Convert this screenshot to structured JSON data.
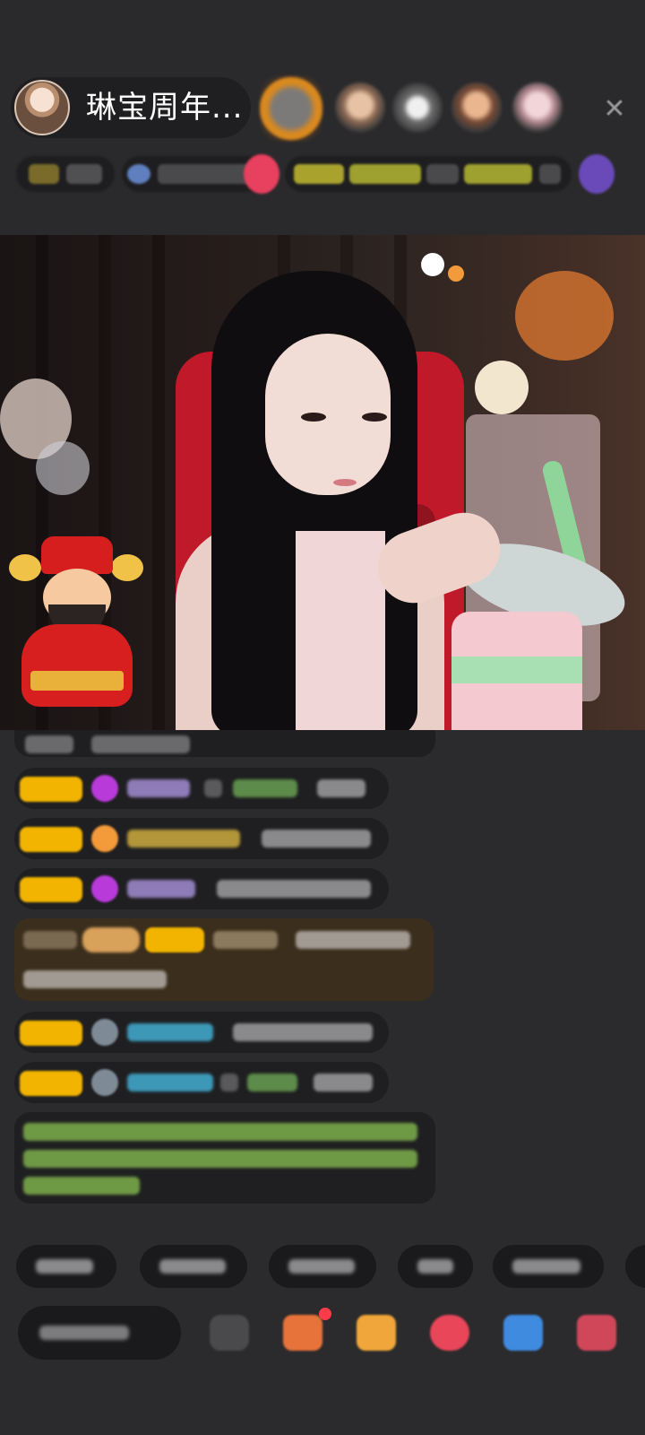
{
  "header": {
    "streamer_name": "琳宝周年...",
    "close_icon": "close-icon"
  },
  "colors": {
    "background": "#2b2b2d",
    "badge_gold": "#f2b400",
    "chat_bubble": "#1f1f21",
    "highlight_bubble": "#3b2e1c"
  },
  "chat": {
    "message_count": 10
  },
  "toolbar": {
    "icons": [
      "emoji-icon",
      "gift-box-icon",
      "fan-badge-icon",
      "lucky-bag-icon",
      "game-icon",
      "more-gift-icon"
    ]
  }
}
